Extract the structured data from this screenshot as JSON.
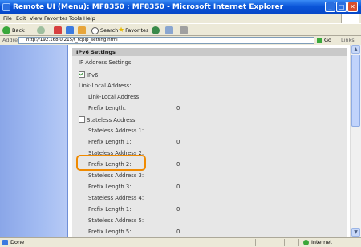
{
  "window": {
    "title": "Remote UI (Menu): MF8350 : MF8350 - Microsoft Internet Explorer",
    "minimize": "_",
    "maximize": "□",
    "close": "✕"
  },
  "menu": [
    "File",
    "Edit",
    "View",
    "Favorites",
    "Tools",
    "Help"
  ],
  "toolbar": {
    "back": "Back",
    "search": "Search",
    "favorites": "Favorites"
  },
  "address": {
    "label": "Address",
    "url": "http://192.168.0.215/t_tcpip_setting.html",
    "go": "Go",
    "links": "Links"
  },
  "settings": {
    "header": "IPv6 Settings",
    "ip_address_settings_label": "IP Address Settings:",
    "ipv6_label": "IPv6",
    "ipv6_checked": true,
    "link_local_section": "Link-Local Address:",
    "link_local_address_label": "Link-Local Address:",
    "prefix_length_label": "Prefix Length:",
    "prefix_length_value": "0",
    "stateless_label": "Stateless Address",
    "stateless_checked": false,
    "addresses": [
      {
        "label": "Stateless Address 1:",
        "prefix_label": "Prefix Length 1:",
        "prefix_value": "0"
      },
      {
        "label": "Stateless Address 2:",
        "prefix_label": "Prefix Length 2:",
        "prefix_value": "0"
      },
      {
        "label": "Stateless Address 3:",
        "prefix_label": "Prefix Length 3:",
        "prefix_value": "0"
      },
      {
        "label": "Stateless Address 4:",
        "prefix_label": "Prefix Length 1:",
        "prefix_value": "0"
      },
      {
        "label": "Stateless Address 5:",
        "prefix_label": "Prefix Length 5:",
        "prefix_value": "0"
      }
    ]
  },
  "status": {
    "left": "Done",
    "zone": "Internet"
  },
  "colors": {
    "highlight": "#f08a00",
    "title_bar": "#0a55d8",
    "left_panel": "#a3bcf2"
  }
}
